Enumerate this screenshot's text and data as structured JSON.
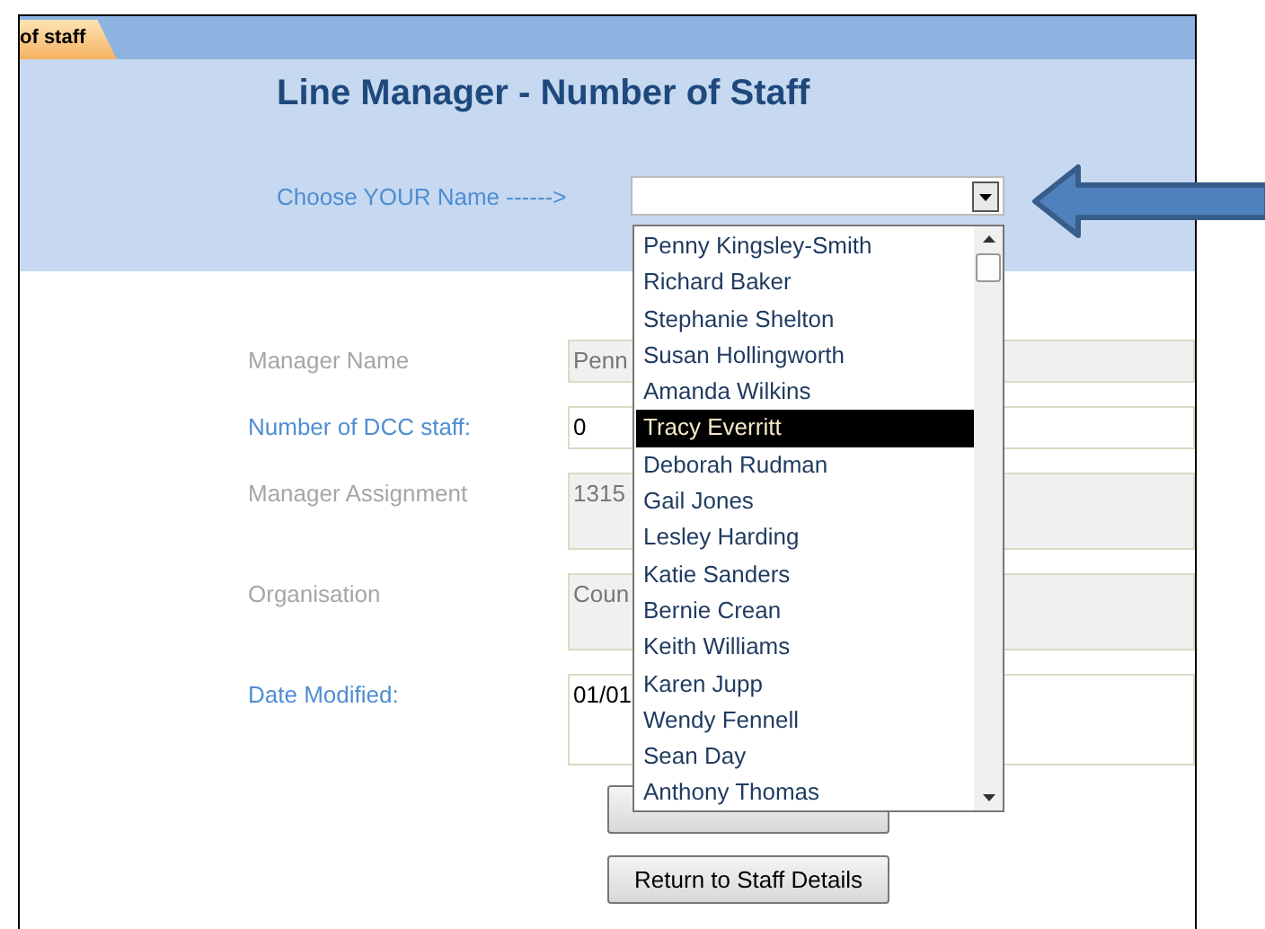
{
  "tab": {
    "label": "of staff"
  },
  "title": "Line Manager - Number of Staff",
  "chooser": {
    "label": "Choose YOUR Name ------>",
    "options": [
      {
        "label": "Penny Kingsley-Smith",
        "selected": false
      },
      {
        "label": "Richard Baker",
        "selected": false
      },
      {
        "label": "Stephanie  Shelton",
        "selected": false
      },
      {
        "label": "Susan Hollingworth",
        "selected": false
      },
      {
        "label": "Amanda Wilkins",
        "selected": false
      },
      {
        "label": "Tracy Everritt",
        "selected": true
      },
      {
        "label": "Deborah Rudman",
        "selected": false
      },
      {
        "label": "Gail Jones",
        "selected": false
      },
      {
        "label": "Lesley Harding",
        "selected": false
      },
      {
        "label": "Katie Sanders",
        "selected": false
      },
      {
        "label": "Bernie Crean",
        "selected": false
      },
      {
        "label": "Keith Williams",
        "selected": false
      },
      {
        "label": "Karen Jupp",
        "selected": false
      },
      {
        "label": "Wendy Fennell",
        "selected": false
      },
      {
        "label": "Sean Day",
        "selected": false
      },
      {
        "label": "Anthony Thomas",
        "selected": false
      }
    ]
  },
  "fields": [
    {
      "label": "Manager Name",
      "value": "Penn",
      "disabled": true,
      "kind": "single"
    },
    {
      "label": "Number of DCC staff:",
      "value": "0",
      "disabled": false,
      "kind": "single"
    },
    {
      "label": "Manager Assignment",
      "value": "1315",
      "disabled": true,
      "kind": "double"
    },
    {
      "label": "Organisation",
      "value": "Coun",
      "disabled": true,
      "kind": "double"
    },
    {
      "label": "Date Modified:",
      "value": "01/01",
      "disabled": false,
      "kind": "triple"
    }
  ],
  "buttons": [
    {
      "kind": "covered"
    },
    {
      "kind": "plain",
      "label": "Return to Staff Details"
    }
  ]
}
